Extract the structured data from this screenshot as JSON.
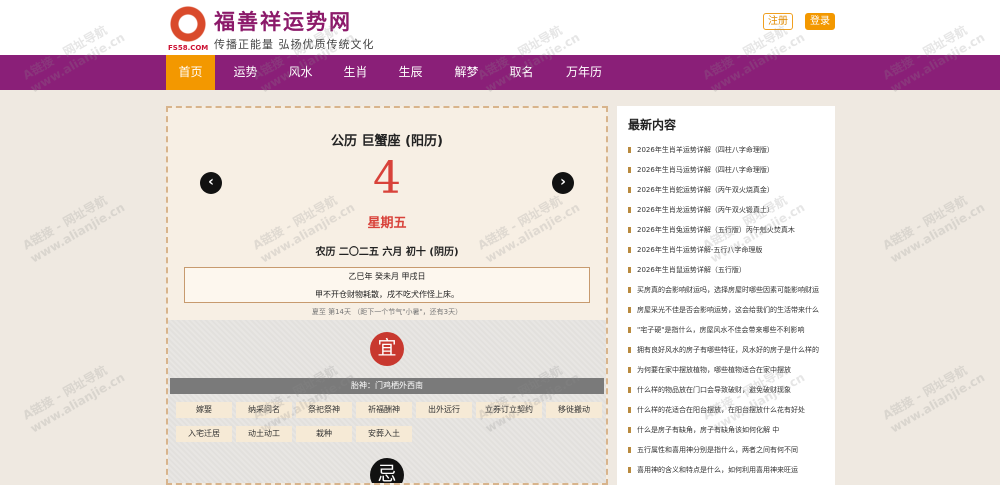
{
  "header": {
    "site_name": "福善祥运势网",
    "slogan": "传播正能量 弘扬优质传统文化",
    "logo_text": "FS58.COM",
    "register": "注册",
    "login": "登录"
  },
  "nav": [
    "首页",
    "运势",
    "风水",
    "生肖",
    "生辰",
    "解梦",
    "取名",
    "万年历"
  ],
  "calendar": {
    "title": "公历 巨蟹座 (阳历)",
    "day": "4",
    "weekday": "星期五",
    "lunar": "农历 二〇二五 六月 初十 (阴历)",
    "ganzhi": "乙巳年 癸未月 甲戌日",
    "taboo_line": "甲不开仓财物耗散，戌不吃犬作怪上床。",
    "solar_term": "夏至 第14天 （距下一个节气\"小暑\"，还有3天）",
    "yi_badge": "宜",
    "ji_badge": "忌",
    "god_direction": "胎神：门鸡栖外西南",
    "yi_items": [
      "嫁娶",
      "纳采问名",
      "祭祀祭神",
      "祈福酬神",
      "出外远行",
      "立券订立契约",
      "移徙搬动",
      "入宅迁居",
      "动土动工",
      "栽种",
      "安葬入土"
    ],
    "prev_icon": "chevron-left-icon",
    "next_icon": "chevron-right-icon"
  },
  "sidebar": {
    "title": "最新内容",
    "items": [
      "2026年生肖羊运势详解（四柱八字命理版）",
      "2026年生肖马运势详解（四柱八字命理版）",
      "2026年生肖蛇运势详解（丙午双火烧真金）",
      "2026年生肖龙运势详解（丙午双火锻真土）",
      "2026年生肖兔运势详解（五行版）丙午剋火焚真木",
      "2026年生肖牛运势详解-五行八字命理版",
      "2026年生肖鼠运势详解（五行版）",
      "买房真的会影响财运吗，选择房屋时哪些因素可能影响财运",
      "房屋采光不佳是否会影响运势，这会给我们的生活带来什么",
      "\"宅子硬\"是指什么，房屋风水不佳会带来哪些不利影响",
      "拥有良好风水的房子有哪些特征，风水好的房子是什么样的",
      "为何要在家中摆放植物，哪些植物适合在家中摆放",
      "什么样的物品放在门口会导致破财，避免破财现象",
      "什么样的花适合在阳台摆放，在阳台摆放什么花有好处",
      "什么是房子有缺角，房子有缺角该如何化解 中",
      "五行属性和喜用神分别是指什么，两者之间有何不同",
      "喜用神的含义和特点是什么，如何利用喜用神来旺运"
    ]
  },
  "watermark": {
    "line1": "A链接 - 网址导航",
    "line2": "www.alianjie.cn"
  },
  "colors": {
    "nav_bg": "#8a1f78",
    "accent": "#f39800",
    "red": "#d8423a",
    "page_bg": "#efe9e1"
  }
}
